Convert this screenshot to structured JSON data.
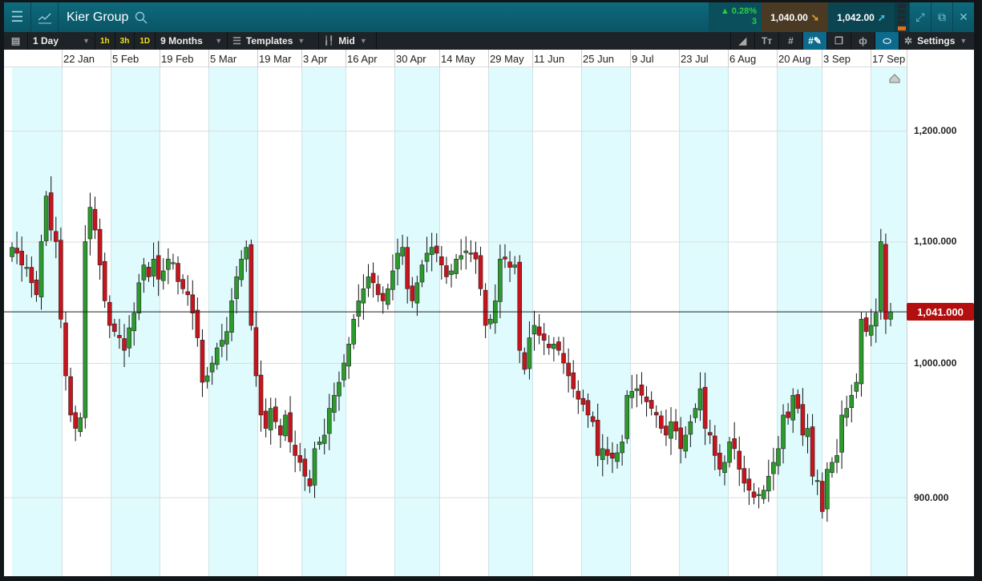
{
  "header": {
    "instrument": "Kier Group",
    "change_pct": "▲ 0.28%",
    "change_pts": "3",
    "sell_price": "1,040.00",
    "buy_price": "1,042.00"
  },
  "toolbar": {
    "interval": "1 Day",
    "quick": [
      "1h",
      "3h",
      "1D"
    ],
    "range": "9 Months",
    "templates": "Templates",
    "price_type": "Mid",
    "settings": "Settings"
  },
  "colors": {
    "up": "#2c9a2c",
    "down": "#c8141c",
    "stripe": "#dffbfd",
    "current": "#b30f0f"
  },
  "chart_data": {
    "type": "candlestick",
    "instrument": "Kier Group",
    "x_tick_labels": [
      "22 Jan",
      "5 Feb",
      "19 Feb",
      "5 Mar",
      "19 Mar",
      "3 Apr",
      "16 Apr",
      "30 Apr",
      "14 May",
      "29 May",
      "11 Jun",
      "25 Jun",
      "9 Jul",
      "23 Jul",
      "6 Aug",
      "20 Aug",
      "3 Sep",
      "17 Sep"
    ],
    "y_ticks": [
      {
        "value": 1200,
        "label": "1,200.000"
      },
      {
        "value": 1100,
        "label": "1,100.000"
      },
      {
        "value": 1000,
        "label": "1,000.000"
      },
      {
        "value": 900,
        "label": "900.000"
      }
    ],
    "y_scale": "log",
    "ylim": [
      860,
      1280
    ],
    "current_price": 1041,
    "current_price_label": "1,041.000",
    "first_open": 1090,
    "closes": [
      1095,
      1090,
      1080,
      1078,
      1065,
      1055,
      1100,
      1140,
      1110,
      1100,
      1035,
      990,
      960,
      950,
      958,
      1100,
      1130,
      1110,
      1080,
      1050,
      1030,
      1025,
      1020,
      1010,
      1028,
      1040,
      1065,
      1080,
      1070,
      1085,
      1068,
      1075,
      1085,
      1082,
      1066,
      1060,
      1055,
      1040,
      1020,
      985,
      990,
      1000,
      1012,
      1018,
      1025,
      1050,
      1070,
      1085,
      1095,
      1030,
      990,
      960,
      950,
      965,
      955,
      945,
      960,
      940,
      930,
      925,
      915,
      908,
      935,
      940,
      945,
      965,
      975,
      985,
      1000,
      1015,
      1035,
      1050,
      1060,
      1070,
      1065,
      1055,
      1050,
      1060,
      1075,
      1090,
      1095,
      1060,
      1050,
      1065,
      1080,
      1090,
      1095,
      1090,
      1080,
      1070,
      1075,
      1085,
      1088,
      1092,
      1090,
      1085,
      1060,
      1030,
      1035,
      1050,
      1085,
      1085,
      1078,
      1080,
      1010,
      995,
      1020,
      1030,
      1022,
      1018,
      1012,
      1015,
      1010,
      1000,
      990,
      980,
      972,
      968,
      960,
      955,
      930,
      935,
      930,
      928,
      932,
      940,
      975,
      978,
      980,
      975,
      970,
      965,
      960,
      950,
      945,
      955,
      948,
      935,
      945,
      955,
      965,
      980,
      950,
      945,
      930,
      920,
      925,
      940,
      935,
      920,
      910,
      905,
      900,
      902,
      905,
      915,
      925,
      935,
      960,
      958,
      975,
      965,
      945,
      950,
      915,
      912,
      890,
      920,
      925,
      930,
      960,
      965,
      975,
      985,
      1035,
      1025,
      1030,
      1040,
      1100,
      1035,
      1041
    ]
  }
}
